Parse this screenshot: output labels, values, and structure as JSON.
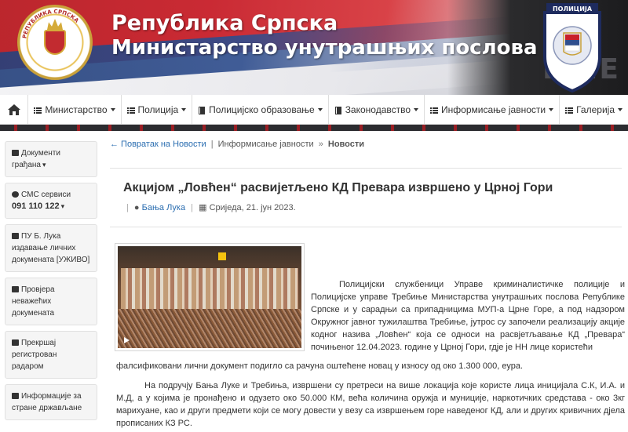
{
  "header": {
    "title_line1": "Република Српска",
    "title_line2": "Министарство унутрашњих послова",
    "coat_text": "РЕПУБЛИКА СРПСКА",
    "badge_text": "ПОЛИЦИЈА",
    "bg_text": "LINE",
    "colors": {
      "red": "#c8202a",
      "blue": "#2f4e8e",
      "white": "#f4f4f6"
    }
  },
  "nav": {
    "items": [
      {
        "label": "Министарство",
        "icon": "list-icon"
      },
      {
        "label": "Полиција",
        "icon": "list-icon"
      },
      {
        "label": "Полицијско образовање",
        "icon": "book-icon"
      },
      {
        "label": "Законодавство",
        "icon": "book-icon"
      },
      {
        "label": "Информисање јавности",
        "icon": "list-icon"
      },
      {
        "label": "Галерија",
        "icon": "list-icon"
      }
    ]
  },
  "sidebar": {
    "items": [
      {
        "label": "Документи грађана",
        "icon": "card-icon"
      },
      {
        "label": "СМС сервиси",
        "sub": "091 110 122",
        "icon": "globe-icon"
      },
      {
        "label": "ПУ Б. Лука издавање личних докумената [УЖИВО]",
        "icon": "video-icon"
      },
      {
        "label": "Провјера неважећих докумената",
        "icon": "card-icon"
      },
      {
        "label": "Прекршај регистрован радаром",
        "icon": "camera-icon"
      },
      {
        "label": "Информације за стране држављане",
        "icon": "document-icon"
      }
    ]
  },
  "breadcrumb": {
    "back": "← Повратак на Новости",
    "sep": "|",
    "section": "Информисање јавности",
    "sep2": "»",
    "current": "Новости"
  },
  "article": {
    "title": "Акцијом „Ловћен“ расвијетљено КД Превара извршено у Црној Гори",
    "location": "Бања Лука",
    "date": "Сриједа, 21. јун 2023.",
    "paragraph1": "Полицијски службеници Управе криминалистичке полиције и Полицијске управе Требиње Министарства унутрашњих послова Републике Српске и у сарадњи са припадницима МУП-а Црне Горе, а под надзором Окружног јавног тужилаштва Требиње, јутрос су започели реализацију акције кодног назива „Ловћен“ која се односи на расвјетљавање КД „Превара“ почињеног 12.04.2023. године у Црној Гори, гдје је НН лице користећи",
    "paragraph1_end": "фалсификовани лични документ подигло са рачуна оштећене новац у износу од око 1.300 000, еура.",
    "paragraph2": "На подручју Бања Луке и Требиња, извршени су претреси на више локација које користе лица иницијала С.К, И.А. и М.Д, а у којима је пронађено и одузето око 50.000 КМ, већа количина оружја и муниције, наркотичких средстава - око 3кг марихуане, као и други предмети који се могу довести у везу са извршењем горе наведеног КД, али и других кривичних дјела прописаних КЗ РС."
  }
}
